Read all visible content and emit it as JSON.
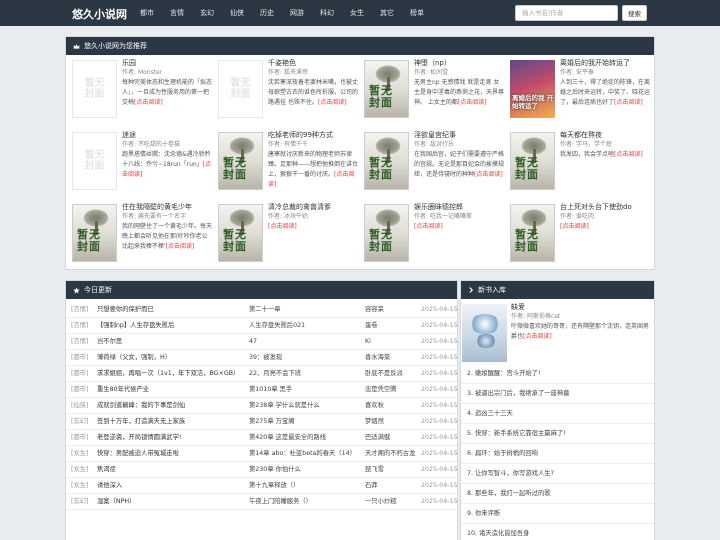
{
  "navbar": {
    "brand": "悠久小说网",
    "links": [
      "都市",
      "言情",
      "玄幻",
      "仙侠",
      "历史",
      "网游",
      "科幻",
      "女生",
      "其它",
      "榜单"
    ],
    "search_placeholder": "输入书名|作者",
    "search_button": "搜索"
  },
  "recommend": {
    "header_icon": "crown-icon",
    "title": "悠久小说网为您推荐",
    "author_prefix": "作者: ",
    "more_label": "[点击阅读]",
    "blank_cover_text": "暂无\n封面",
    "books": [
      {
        "title": "乐园",
        "author": "Monster",
        "desc": "每种完美体态和生理机能的「拟态人」，一旦成为性服务用的第一把交椅",
        "cover": "blank"
      },
      {
        "title": "千姿艳色",
        "author": "狐天溪帝",
        "desc": "沈若寒深夜着老婆林米嘴，也被丈母娘塑古衣的谁色所折服，公司的路遇挂 也殊不住。",
        "cover": "blank"
      },
      {
        "title": "神堕（np）",
        "author": "松间雪",
        "desc": "无男主np 无感情戏 就是走肾 女主是身中淫毒的燕俏之花，天界尊神。 上女主的都",
        "cover": "photo",
        "cover_text": "暂无\n封面"
      },
      {
        "title": "离婚后的我开始转运了",
        "author": "安平泰",
        "desc": "人到三十，得了绝症的陈锋，在离婚之后时来运转，中奖了、晓花运了，最后连病也好了",
        "cover": "anime",
        "cover_text": "离婚后的我\n开始转运了"
      },
      {
        "title": "迷途",
        "author": "不吃甜的十卷猫",
        "desc": "跑黑塔情丝赐：沈念德&遇冷骄矜十八线：乔兮~18run「run」",
        "cover": "blank"
      },
      {
        "title": "吃掉老师的99种方式",
        "author": "有情千千",
        "desc": "唐寒就讨厌新来的物理老师苏律臻。足那种——想把他推倒在讲台上，狠狠干一番的讨厌。",
        "cover": "photo",
        "cover_text": "暂无\n封面"
      },
      {
        "title": "淫欲皇宫纪事",
        "author": "敌对行乐",
        "desc": "在我国后宫，妃子们需要遵守严格的宫规。无论是那目妃会的挨摸规矩，还是侍寝时的种种",
        "cover": "photo",
        "cover_text": "暂无\n封面"
      },
      {
        "title": "每天都在熬夜",
        "author": "学马，学个屁",
        "desc": "我发四，我会学点啥",
        "cover": "photo",
        "cover_text": "暂无\n封面"
      },
      {
        "title": "住在我隔壁的黄毛少年",
        "author": "酱先要有一个名字",
        "desc": "我的网壁住了一个黄毛少年。每天晚上都会听见他在那间'吵你老公比起来我棒不棒'",
        "cover": "photo",
        "cover_text": "暂无\n封面"
      },
      {
        "title": "清冷总裁的禽兽清爹",
        "author": "冰块午奶",
        "desc": "",
        "cover": "photo",
        "cover_text": "暂无\n封面"
      },
      {
        "title": "娱乐圈昧德控郎",
        "author": "吃我一记嘴嘴拳",
        "desc": "",
        "cover": "photo",
        "cover_text": "暂无\n封面"
      },
      {
        "title": "台上死对头台下使劲do",
        "author": "爱吃肉",
        "desc": "",
        "cover": "photo",
        "cover_text": "暂无\n封面"
      }
    ]
  },
  "today": {
    "header_icon": "star-icon",
    "title": "今日更新",
    "rows": [
      {
        "cat": "[言情]",
        "name": "只想要你的保护而已",
        "chapter": "第二十一章",
        "author": "容容呆",
        "date": "2025-04-15"
      },
      {
        "cat": "[言情]",
        "name": "【强制np】人生存盘失败后",
        "chapter": "人生存盘失败后021",
        "author": "蛋卷",
        "date": "2025-04-15"
      },
      {
        "cat": "[言情]",
        "name": "岂不尔思",
        "chapter": "47",
        "author": "Ki",
        "date": "2025-04-15"
      },
      {
        "cat": "[都市]",
        "name": "薄荷绿（父女，强制，H）",
        "chapter": "39：被发现",
        "author": "香水海棠",
        "date": "2025-04-15"
      },
      {
        "cat": "[都市]",
        "name": "求求姐姐，再唱一次（1v1，年下双洁，BG×GB）",
        "chapter": "22、月亮不会下班",
        "author": "卧底不是反派",
        "date": "2025-04-15"
      },
      {
        "cat": "[都市]",
        "name": "重生80年代侯产业",
        "chapter": "第1010章 黑手",
        "author": "忠是凭空腾",
        "date": "2025-04-15"
      },
      {
        "cat": "[仙侠]",
        "name": "成就剑道巅峰：我的下事是剑仙",
        "chapter": "第238章 学什么就是什么",
        "author": "喜欢秋",
        "date": "2025-04-15"
      },
      {
        "cat": "[玄幻]",
        "name": "签到十万年，打造满天无上家族",
        "chapter": "第275章 万宝阁",
        "author": "梦烟然",
        "date": "2025-04-15"
      },
      {
        "cat": "[都市]",
        "name": "老登逆袭，开局锁情圆满武学!",
        "chapter": "第420章 这是最安全的路线",
        "author": "巴适满俄",
        "date": "2025-04-15"
      },
      {
        "cat": "[女生]",
        "name": "快穿：男配被迫人带冤城走啦",
        "chapter": "第14章 abo：杜蓝beta的春天（14）",
        "author": "天才阁的不朽古龙",
        "date": "2025-04-15"
      },
      {
        "cat": "[女生]",
        "name": "焦渴症",
        "chapter": "第230章 你怕什么",
        "author": "琵飞雪",
        "date": "2025-04-15"
      },
      {
        "cat": "[女生]",
        "name": "诱他深入",
        "chapter": "第十九章释放（）",
        "author": "石莽",
        "date": "2025-04-15"
      },
      {
        "cat": "[玄幻]",
        "name": "湿案（NPH）",
        "chapter": "午夜上门陪睡服务（）",
        "author": "一只小炒糙",
        "date": "2025-04-15"
      }
    ]
  },
  "newbooks": {
    "header_icon": "chevron-right-icon",
    "title": "新书入库",
    "featured": {
      "title": "缺爱",
      "author": "阿斯伯格cat",
      "desc": "叶微微喜欢她的哥哥，还有隔壁那个沈钥，连英国男爵也"
    },
    "items": [
      "2. 嫩娘醒醒：宫斗开始了!",
      "3. 被逼出宗门后，我继承了一座神墓",
      "4. 追凶三十三天",
      "5. 快穿：新手系统它靠宿主赢麻了!",
      "6. 扁环：始于树梢的回响",
      "7. 让你写智斗，你写游戏人生?",
      "8. 那些年，我打一起听过的歌",
      "9. 你来评断",
      "10. 诸天造化皆加吾身"
    ]
  }
}
